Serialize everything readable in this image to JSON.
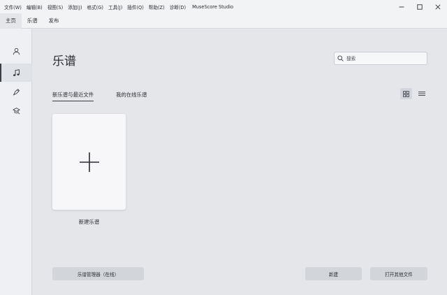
{
  "menubar": {
    "items": [
      "文件(W)",
      "编辑(B)",
      "视图(S)",
      "添加(J)",
      "格式(G)",
      "工具(J)",
      "插件(Q)",
      "帮助(Z)",
      "诊断(D)"
    ],
    "app_title": "MuseScore Studio"
  },
  "tabs": [
    "主页",
    "乐谱",
    "发布"
  ],
  "sidebar": {
    "items": [
      {
        "icon": "account-icon"
      },
      {
        "icon": "music-note-icon",
        "active": true
      },
      {
        "icon": "plugins-icon"
      },
      {
        "icon": "learn-icon"
      }
    ]
  },
  "main": {
    "title": "乐谱",
    "search_placeholder": "搜索",
    "subtabs": [
      "新乐谱与最近文件",
      "我的在线乐谱"
    ],
    "new_score_label": "新建乐谱",
    "buttons": {
      "manager": "乐谱管理器（在线）",
      "new": "新建",
      "open_other": "打开其他文件"
    }
  },
  "colors": {
    "background": "#e4e6ea",
    "card": "#f7f7f9",
    "button": "#d2d5da",
    "text": "#2d2d33"
  }
}
